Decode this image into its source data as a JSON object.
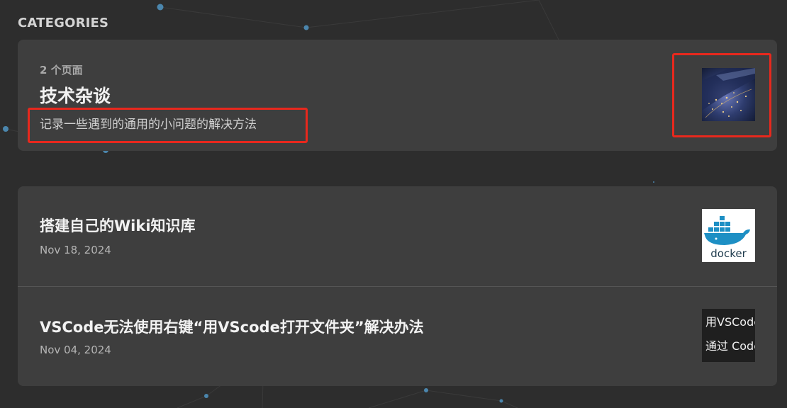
{
  "section": {
    "title": "CATEGORIES"
  },
  "category": {
    "meta": "2 个页面",
    "name": "技术杂谈",
    "description": "记录一些遇到的通用的小问题的解决方法",
    "thumbnail_icon": "night-city-aerial-image"
  },
  "posts": [
    {
      "title": "搭建自己的Wiki知识库",
      "date": "Nov 18, 2024",
      "thumbnail": {
        "icon": "docker-logo",
        "text": "docker",
        "color": "#1d8fc4"
      }
    },
    {
      "title": "VSCode无法使用右键“用VScode打开文件夹”解决办法",
      "date": "Nov 04, 2024",
      "thumbnail": {
        "icon": "vscode-text-preview",
        "lines": [
          "用VSCode",
          "通过 Code"
        ]
      }
    }
  ],
  "colors": {
    "background": "#2d2d2d",
    "card": "#3e3e3e",
    "highlight": "#e8281d",
    "node": "#4b86ad"
  }
}
